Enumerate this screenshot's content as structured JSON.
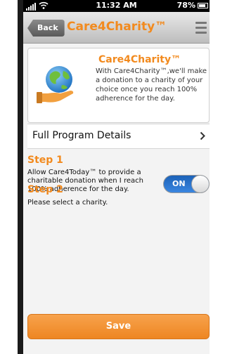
{
  "status_bar": {
    "time": "11:32 AM",
    "battery": "78%",
    "icons": [
      "signal-icon",
      "wifi-icon",
      "battery-icon"
    ]
  },
  "nav": {
    "back_label": "Back",
    "title": "Care4Charity™",
    "menu_icon": "menu-icon"
  },
  "info_card": {
    "title": "Care4Charity™",
    "description": "With Care4Charity™,we'll make a donation to a charity of your choice once you reach 100% adherence for the day.",
    "icon": "globe-in-hand-icon"
  },
  "details": {
    "label": "Full Program Details",
    "icon": "chevron-right-icon"
  },
  "step1": {
    "title": "Step 1",
    "text": "Allow Care4Today™ to provide a charitable donation when I reach 100% adherence for the day.",
    "toggle_label": "ON"
  },
  "step2": {
    "title": "Step 2",
    "text": "Please select a charity."
  },
  "save_label": "Save",
  "colors": {
    "accent": "#f28a1e",
    "toggle_on": "#2a74d0"
  }
}
